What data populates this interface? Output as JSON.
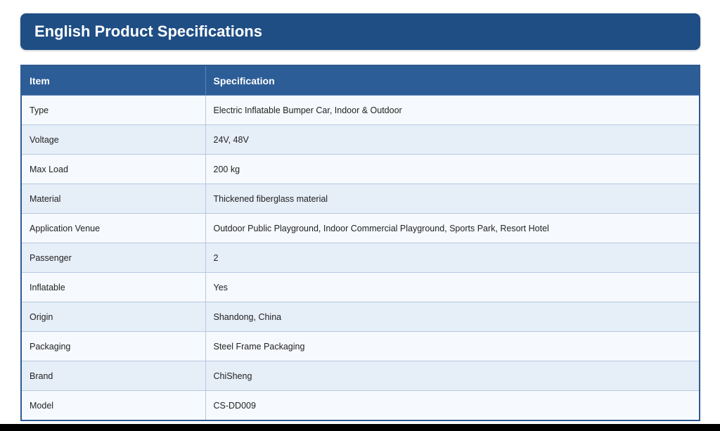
{
  "header": {
    "title": "English Product Specifications"
  },
  "table": {
    "columns": [
      "Item",
      "Specification"
    ],
    "rows": [
      {
        "item": "Type",
        "spec": "Electric Inflatable Bumper Car, Indoor & Outdoor"
      },
      {
        "item": "Voltage",
        "spec": "24V, 48V"
      },
      {
        "item": "Max Load",
        "spec": "200 kg"
      },
      {
        "item": "Material",
        "spec": "Thickened fiberglass material"
      },
      {
        "item": "Application Venue",
        "spec": "Outdoor Public Playground, Indoor Commercial Playground, Sports Park, Resort Hotel"
      },
      {
        "item": "Passenger",
        "spec": "2"
      },
      {
        "item": "Inflatable",
        "spec": "Yes"
      },
      {
        "item": "Origin",
        "spec": "Shandong, China"
      },
      {
        "item": "Packaging",
        "spec": "Steel Frame Packaging"
      },
      {
        "item": "Brand",
        "spec": "ChiSheng"
      },
      {
        "item": "Model",
        "spec": "CS-DD009"
      }
    ]
  },
  "colors": {
    "header_bg": "#1f4e84",
    "table_header_bg": "#2d5d97",
    "row_odd": "#f6f9fd",
    "row_even": "#e6eef8"
  }
}
